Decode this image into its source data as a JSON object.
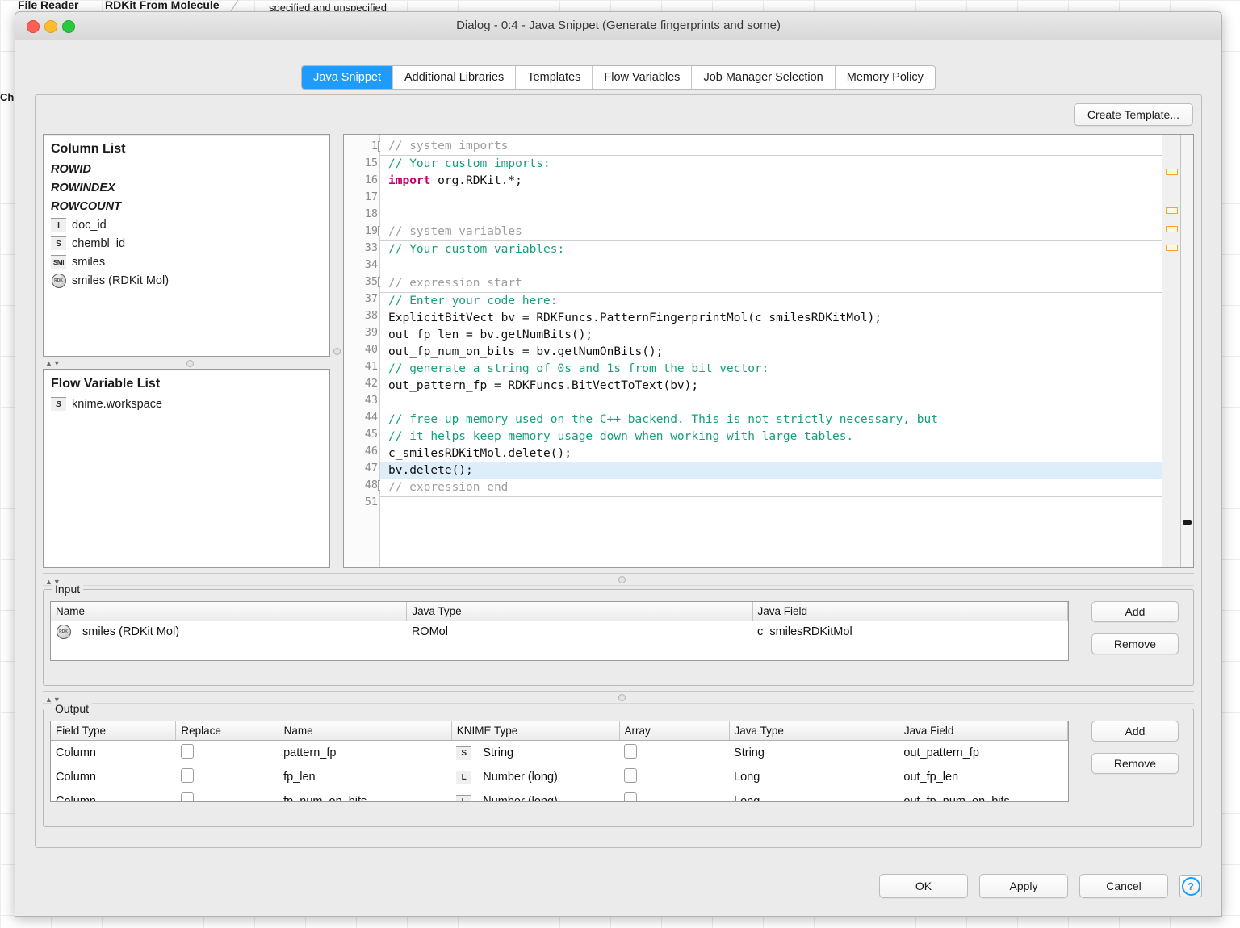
{
  "background": {
    "node_label_left": "File Reader",
    "node_label_right": "RDKit From Molecule",
    "annotation": "specified and unspecified",
    "side_label": "Ch"
  },
  "window": {
    "title": "Dialog - 0:4 - Java Snippet (Generate fingerprints and some)",
    "traffic_lights": [
      "close-icon",
      "minimize-icon",
      "zoom-icon"
    ]
  },
  "tabs": [
    {
      "label": "Java Snippet",
      "active": true
    },
    {
      "label": "Additional Libraries",
      "active": false
    },
    {
      "label": "Templates",
      "active": false
    },
    {
      "label": "Flow Variables",
      "active": false
    },
    {
      "label": "Job Manager Selection",
      "active": false
    },
    {
      "label": "Memory Policy",
      "active": false
    }
  ],
  "toolbar": {
    "create_template_label": "Create Template..."
  },
  "column_list": {
    "title": "Column List",
    "items": [
      {
        "label": "ROWID",
        "icon": "",
        "italic": true
      },
      {
        "label": "ROWINDEX",
        "icon": "",
        "italic": true
      },
      {
        "label": "ROWCOUNT",
        "icon": "",
        "italic": true
      },
      {
        "label": "doc_id",
        "icon": "I",
        "italic": false
      },
      {
        "label": "chembl_id",
        "icon": "S",
        "italic": false
      },
      {
        "label": "smiles",
        "icon": "SMI",
        "italic": false
      },
      {
        "label": "smiles (RDKit Mol)",
        "icon": "RDKit",
        "italic": false
      }
    ]
  },
  "flow_variable_list": {
    "title": "Flow Variable List",
    "items": [
      {
        "label": "knime.workspace",
        "icon": "S"
      }
    ]
  },
  "editor": {
    "lines": [
      {
        "num": "1",
        "fold": true,
        "text": "// system imports",
        "style": "folded"
      },
      {
        "num": "15",
        "fold": false,
        "text": "// Your custom imports:",
        "style": "comment"
      },
      {
        "num": "16",
        "fold": false,
        "text": "import org.RDKit.*;",
        "style": "import"
      },
      {
        "num": "17",
        "fold": false,
        "text": "",
        "style": "plain"
      },
      {
        "num": "18",
        "fold": false,
        "text": "",
        "style": "plain"
      },
      {
        "num": "19",
        "fold": true,
        "text": "// system variables",
        "style": "folded"
      },
      {
        "num": "33",
        "fold": false,
        "text": "// Your custom variables:",
        "style": "comment"
      },
      {
        "num": "34",
        "fold": false,
        "text": "",
        "style": "plain"
      },
      {
        "num": "35",
        "fold": true,
        "text": "// expression start",
        "style": "folded"
      },
      {
        "num": "37",
        "fold": false,
        "text": "// Enter your code here:",
        "style": "comment"
      },
      {
        "num": "38",
        "fold": false,
        "text": "ExplicitBitVect bv = RDKFuncs.PatternFingerprintMol(c_smilesRDKitMol);",
        "style": "plain"
      },
      {
        "num": "39",
        "fold": false,
        "text": "out_fp_len = bv.getNumBits();",
        "style": "plain"
      },
      {
        "num": "40",
        "fold": false,
        "text": "out_fp_num_on_bits = bv.getNumOnBits();",
        "style": "plain"
      },
      {
        "num": "41",
        "fold": false,
        "text": "// generate a string of 0s and 1s from the bit vector:",
        "style": "comment"
      },
      {
        "num": "42",
        "fold": false,
        "text": "out_pattern_fp = RDKFuncs.BitVectToText(bv);",
        "style": "plain"
      },
      {
        "num": "43",
        "fold": false,
        "text": "",
        "style": "plain"
      },
      {
        "num": "44",
        "fold": false,
        "text": "// free up memory used on the C++ backend. This is not strictly necessary, but",
        "style": "comment"
      },
      {
        "num": "45",
        "fold": false,
        "text": "// it helps keep memory usage down when working with large tables.",
        "style": "comment"
      },
      {
        "num": "46",
        "fold": false,
        "text": "c_smilesRDKitMol.delete();",
        "style": "plain"
      },
      {
        "num": "47",
        "fold": false,
        "text": "bv.delete();",
        "style": "highlight"
      },
      {
        "num": "48",
        "fold": true,
        "text": "// expression end",
        "style": "folded"
      },
      {
        "num": "51",
        "fold": false,
        "text": "",
        "style": "plain"
      }
    ],
    "error_marker_tops": [
      42,
      90,
      115,
      140
    ],
    "accent_fold_color": "#9e9e9e",
    "comment_color": "#16a07a",
    "keyword_color": "#c3006e",
    "highlight_color": "#ddedfa",
    "marker_color": "#f5a623"
  },
  "input_section": {
    "legend": "Input",
    "columns": [
      "Name",
      "Java Type",
      "Java Field"
    ],
    "rows": [
      {
        "name": "smiles (RDKit Mol)",
        "icon": "RDKit",
        "java_type": "ROMol",
        "java_field": "c_smilesRDKitMol"
      }
    ],
    "buttons": {
      "add": "Add",
      "remove": "Remove"
    }
  },
  "output_section": {
    "legend": "Output",
    "columns": [
      "Field Type",
      "Replace",
      "Name",
      "KNIME Type",
      "Array",
      "Java Type",
      "Java Field"
    ],
    "rows": [
      {
        "field_type": "Column",
        "replace": false,
        "name": "pattern_fp",
        "knime_type": "String",
        "knime_icon": "S",
        "array": false,
        "java_type": "String",
        "java_field": "out_pattern_fp"
      },
      {
        "field_type": "Column",
        "replace": false,
        "name": "fp_len",
        "knime_type": "Number (long)",
        "knime_icon": "L",
        "array": false,
        "java_type": "Long",
        "java_field": "out_fp_len"
      },
      {
        "field_type": "Column",
        "replace": false,
        "name": "fp_num_on_bits",
        "knime_type": "Number (long)",
        "knime_icon": "L",
        "array": false,
        "java_type": "Long",
        "java_field": "out_fp_num_on_bits"
      }
    ],
    "buttons": {
      "add": "Add",
      "remove": "Remove"
    }
  },
  "footer": {
    "ok": "OK",
    "apply": "Apply",
    "cancel": "Cancel",
    "help": "?"
  },
  "colors": {
    "accent": "#1e9bfb",
    "dialog_bg": "#ebebeb",
    "panel_border": "#bdbdbd"
  }
}
